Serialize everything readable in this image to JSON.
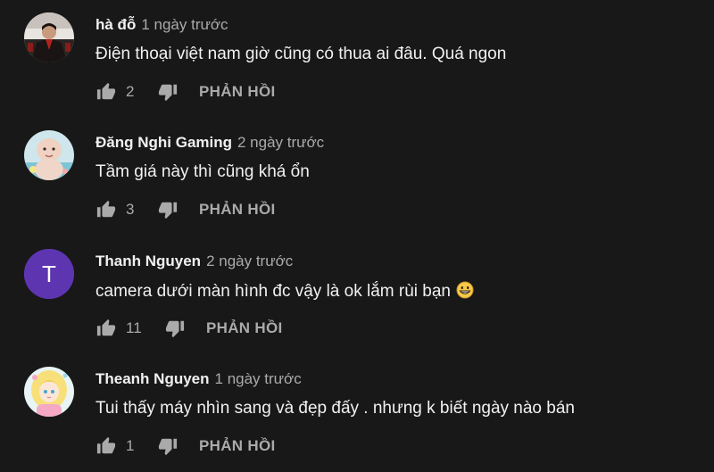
{
  "comments": [
    {
      "author": "hà đỗ",
      "time": "1 ngày trước",
      "text": "Điện thoại việt nam giờ cũng có thua ai đâu. Quá ngon",
      "likes": "2",
      "reply_label": "PHẢN HỒI",
      "avatar_icon": "person-photo-avatar"
    },
    {
      "author": "Đăng Nghi Gaming",
      "time": "2 ngày trước",
      "text": "Tầm giá này thì cũng khá ổn",
      "likes": "3",
      "reply_label": "PHẢN HỒI",
      "avatar_icon": "baby-photo-avatar"
    },
    {
      "author": "Thanh Nguyen",
      "time": "2 ngày trước",
      "text": "camera dưới màn hình đc  vậy là ok lắm rùi bạn",
      "likes": "11",
      "reply_label": "PHẢN HỒI",
      "avatar_letter": "T",
      "avatar_color": "#5e35b1",
      "emoji": "grinning-face-emoji"
    },
    {
      "author": "Theanh Nguyen",
      "time": "1 ngày trước",
      "text": "Tui thấy máy nhìn sang và đẹp đấy . nhưng k biết ngày nào bán",
      "likes": "1",
      "reply_label": "PHẢN HỒI",
      "avatar_icon": "anime-character-avatar"
    }
  ],
  "colors": {
    "background": "#181818",
    "primary_text": "#f1f1f1",
    "secondary_text": "#aaaaaa"
  }
}
